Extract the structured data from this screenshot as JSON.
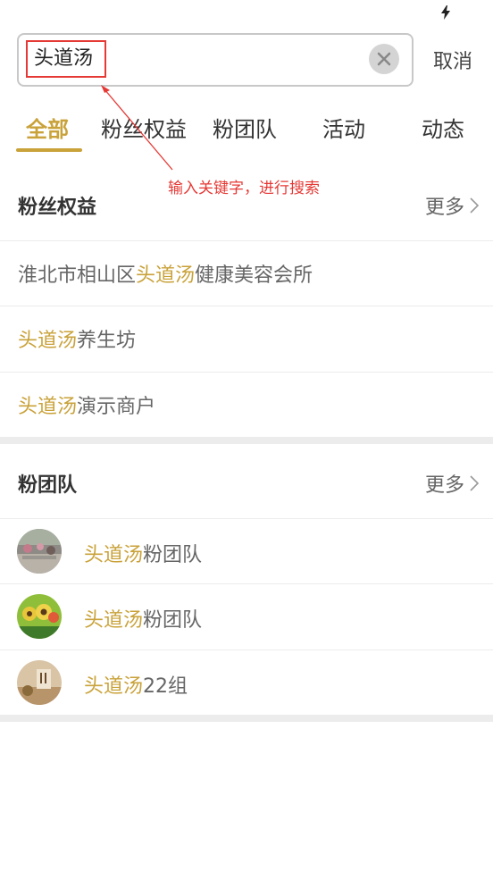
{
  "search": {
    "query": "头道汤",
    "cancel_label": "取消",
    "annotation": "输入关键字，进行搜索"
  },
  "tabs": [
    {
      "label": "全部",
      "active": true
    },
    {
      "label": "粉丝权益",
      "active": false
    },
    {
      "label": "粉团队",
      "active": false
    },
    {
      "label": "活动",
      "active": false
    },
    {
      "label": "动态",
      "active": false
    }
  ],
  "fan_benefits": {
    "title": "粉丝权益",
    "more": "更多",
    "items": [
      {
        "prefix": "淮北市相山区",
        "keyword": "头道汤",
        "suffix": "健康美容会所"
      },
      {
        "prefix": "",
        "keyword": "头道汤",
        "suffix": "养生坊"
      },
      {
        "prefix": "",
        "keyword": "头道汤",
        "suffix": "演示商户"
      }
    ]
  },
  "fan_teams": {
    "title": "粉团队",
    "more": "更多",
    "items": [
      {
        "keyword": "头道汤",
        "suffix": "粉团队"
      },
      {
        "keyword": "头道汤",
        "suffix": "粉团队"
      },
      {
        "keyword": "头道汤",
        "suffix": "22组"
      }
    ]
  },
  "colors": {
    "accent": "#c9a23a",
    "annotation": "#e53935"
  }
}
